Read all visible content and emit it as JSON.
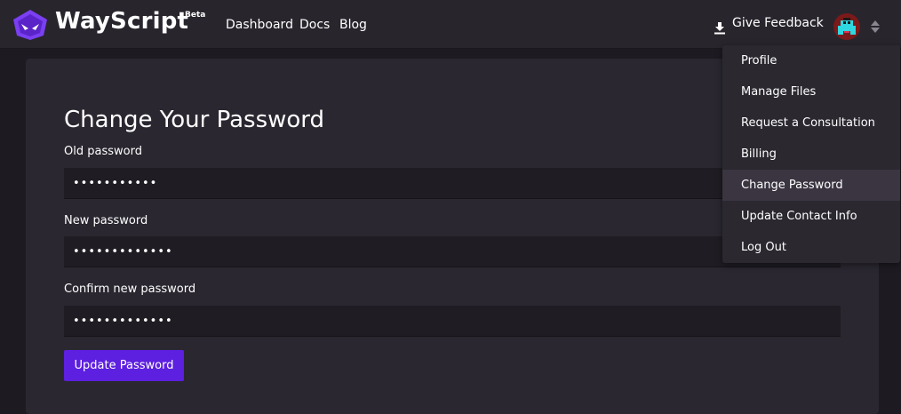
{
  "header": {
    "brand": "WayScript",
    "badge": "Beta",
    "nav": [
      "Dashboard",
      "Docs",
      "Blog"
    ],
    "feedback_label": "Give Feedback"
  },
  "form": {
    "title": "Change Your Password",
    "old_label": "Old password",
    "old_value": "•••••••••••",
    "new_label": "New password",
    "new_value": "•••••••••••••",
    "confirm_label": "Confirm new password",
    "confirm_value": "•••••••••••••",
    "submit_label": "Update Password"
  },
  "menu": {
    "items": [
      "Profile",
      "Manage Files",
      "Request a Consultation",
      "Billing",
      "Change Password",
      "Update Contact Info",
      "Log Out"
    ],
    "active": "Change Password"
  },
  "colors": {
    "accent": "#5d1fe0",
    "logo": "#7b3ff2",
    "navbar": "#28252d",
    "panel": "#2a2730",
    "menu_active": "#3b3542"
  },
  "icons": {
    "logo": "wayscript-logo-icon",
    "feedback": "download-icon",
    "avatar": "avatar",
    "menu_toggle": "sort-arrows-icon"
  }
}
